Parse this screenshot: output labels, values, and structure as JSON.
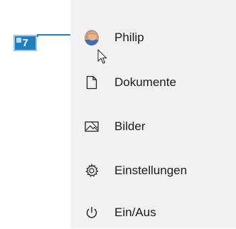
{
  "callout": {
    "number": "7"
  },
  "menu": {
    "items": [
      {
        "label": "Philip",
        "icon": "user-avatar"
      },
      {
        "label": "Dokumente",
        "icon": "document-icon"
      },
      {
        "label": "Bilder",
        "icon": "picture-icon"
      },
      {
        "label": "Einstellungen",
        "icon": "gear-icon"
      },
      {
        "label": "Ein/Aus",
        "icon": "power-icon"
      }
    ]
  },
  "colors": {
    "panel_bg": "#f2f2f2",
    "callout": "#1f7fbf",
    "text": "#1a1a1a"
  }
}
